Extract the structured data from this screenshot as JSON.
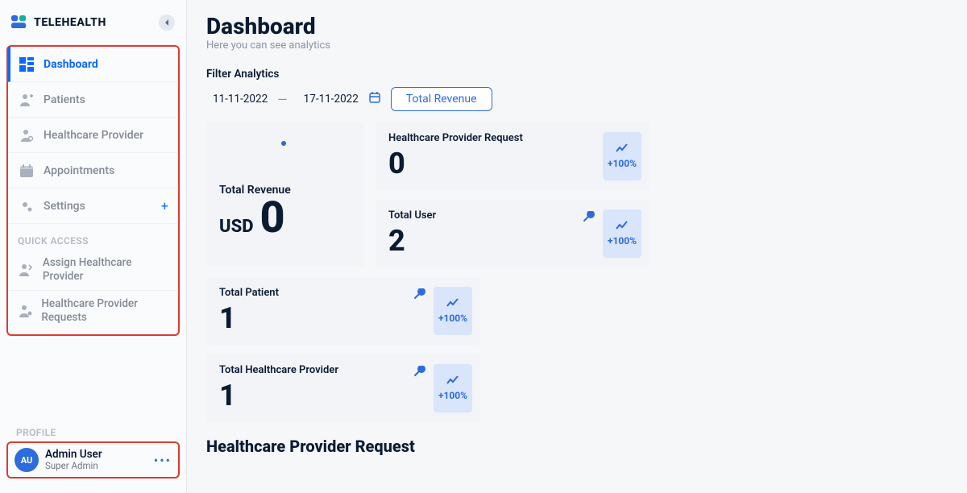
{
  "brand": {
    "name": "TELEHEALTH"
  },
  "sidebar": {
    "items": [
      {
        "icon": "dashboard",
        "label": "Dashboard",
        "active": true
      },
      {
        "icon": "patients",
        "label": "Patients",
        "active": false
      },
      {
        "icon": "provider",
        "label": "Healthcare Provider",
        "active": false
      },
      {
        "icon": "calendar",
        "label": "Appointments",
        "active": false
      },
      {
        "icon": "gears",
        "label": "Settings",
        "active": false,
        "plus": true
      }
    ],
    "quick_header": "QUICK ACCESS",
    "quick": [
      {
        "icon": "assign",
        "label": "Assign Healthcare Provider"
      },
      {
        "icon": "requests",
        "label": "Healthcare Provider Requests"
      }
    ]
  },
  "profile": {
    "header": "PROFILE",
    "initials": "AU",
    "name": "Admin User",
    "role": "Super Admin"
  },
  "page": {
    "title": "Dashboard",
    "subtitle": "Here you can see analytics",
    "section_header": "Healthcare Provider Request"
  },
  "filter": {
    "label": "Filter Analytics",
    "from": "11-11-2022",
    "to": "17-11-2022",
    "revenue_button": "Total Revenue"
  },
  "cards": {
    "revenue": {
      "title": "Total Revenue",
      "currency": "USD",
      "value": "0"
    },
    "provider_request": {
      "title": "Healthcare Provider Request",
      "value": "0",
      "pct": "+100%"
    },
    "total_user": {
      "title": "Total User",
      "value": "2",
      "pct": "+100%"
    },
    "total_patient": {
      "title": "Total Patient",
      "value": "1",
      "pct": "+100%"
    },
    "total_provider": {
      "title": "Total Healthcare Provider",
      "value": "1",
      "pct": "+100%"
    }
  }
}
